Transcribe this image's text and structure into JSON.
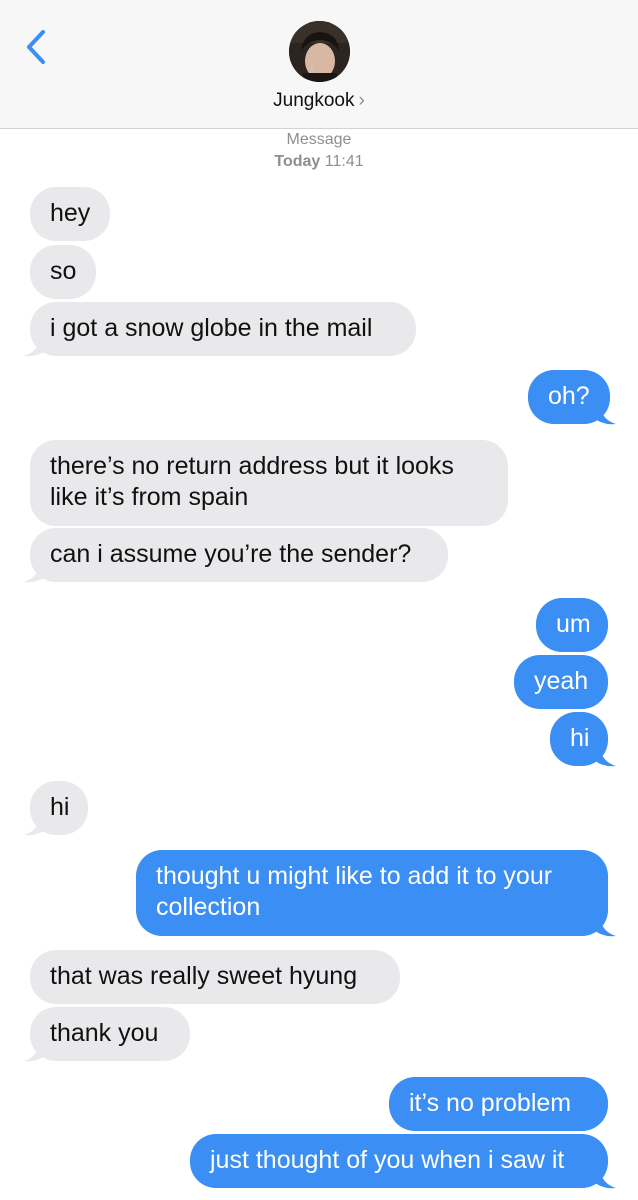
{
  "header": {
    "contact_name": "Jungkook",
    "chevron": "›",
    "back_icon": "chevron-left-icon",
    "accent_color": "#3b8ef3"
  },
  "thread_meta": {
    "service": "Message",
    "day": "Today",
    "time": "11:41"
  },
  "messages": [
    {
      "from": "them",
      "text": "hey"
    },
    {
      "from": "them",
      "text": "so"
    },
    {
      "from": "them",
      "text": "i got a snow globe in the mail"
    },
    {
      "from": "me",
      "text": "oh?"
    },
    {
      "from": "them",
      "text": "there’s no return address but it looks like it’s from spain"
    },
    {
      "from": "them",
      "text": "can i assume you’re the sender?"
    },
    {
      "from": "me",
      "text": "um"
    },
    {
      "from": "me",
      "text": "yeah"
    },
    {
      "from": "me",
      "text": "hi"
    },
    {
      "from": "them",
      "text": "hi"
    },
    {
      "from": "me",
      "text": "thought u might like to add it to your collection"
    },
    {
      "from": "them",
      "text": "that was really sweet hyung"
    },
    {
      "from": "them",
      "text": "thank you"
    },
    {
      "from": "me",
      "text": "it’s no problem"
    },
    {
      "from": "me",
      "text": "just thought of you when i saw it"
    }
  ]
}
